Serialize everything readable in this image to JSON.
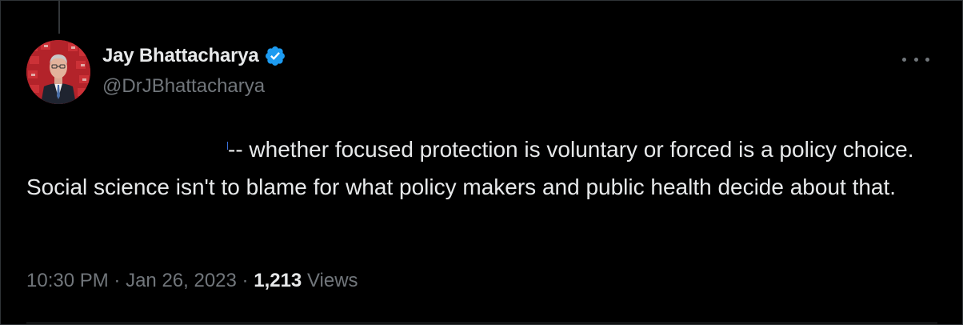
{
  "tweet": {
    "author": {
      "display_name": "Jay Bhattacharya",
      "handle": "@DrJBhattacharya",
      "verified": true,
      "verified_color": "#1d9bf0"
    },
    "text": "-- whether focused protection is voluntary or forced is a policy choice. Social science isn't to blame for what policy makers and public health decide about that.",
    "time": "10:30 PM",
    "date": "Jan 26, 2023",
    "separator": "·",
    "views_count": "1,213",
    "views_label": "Views"
  },
  "icons": {
    "more": "more-horizontal-icon",
    "verified": "verified-badge-icon"
  },
  "colors": {
    "background": "#000000",
    "text_primary": "#e7e9ea",
    "text_secondary": "#71767b",
    "avatar_bg": "#b3232a"
  }
}
